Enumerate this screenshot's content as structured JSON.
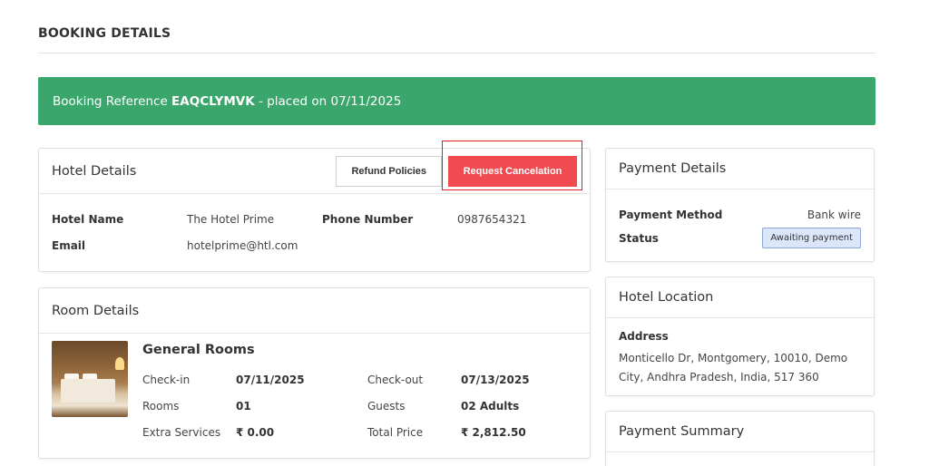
{
  "page": {
    "title": "BOOKING DETAILS"
  },
  "banner": {
    "prefix": "Booking Reference ",
    "reference": "EAQCLYMVK",
    "suffix": " - placed on 07/11/2025",
    "color": "#3aa66b"
  },
  "hotel_details": {
    "title": "Hotel Details",
    "refund_button": "Refund Policies",
    "cancel_button": "Request Cancelation",
    "hotel_name_label": "Hotel Name",
    "hotel_name": "The Hotel Prime",
    "phone_label": "Phone Number",
    "phone": "0987654321",
    "email_label": "Email",
    "email": "hotelprime@htl.com"
  },
  "room_details": {
    "title": "Room Details",
    "room_name": "General Rooms",
    "checkin_label": "Check-in",
    "checkin": "07/11/2025",
    "checkout_label": "Check-out",
    "checkout": "07/13/2025",
    "rooms_label": "Rooms",
    "rooms": "01",
    "guests_label": "Guests",
    "guests": "02 Adults",
    "extra_label": "Extra Services",
    "extra": "₹ 0.00",
    "total_label": "Total Price",
    "total": "₹ 2,812.50"
  },
  "payment_details": {
    "title": "Payment Details",
    "method_label": "Payment Method",
    "method": "Bank wire",
    "status_label": "Status",
    "status": "Awaiting payment"
  },
  "hotel_location": {
    "title": "Hotel Location",
    "address_label": "Address",
    "address": "Monticello Dr, Montgomery, 10010, Demo City, Andhra Pradesh, India, 517 360"
  },
  "payment_summary": {
    "title": "Payment Summary"
  },
  "colors": {
    "accent_red": "#f04b50",
    "badge_bg": "#dce6fa"
  }
}
